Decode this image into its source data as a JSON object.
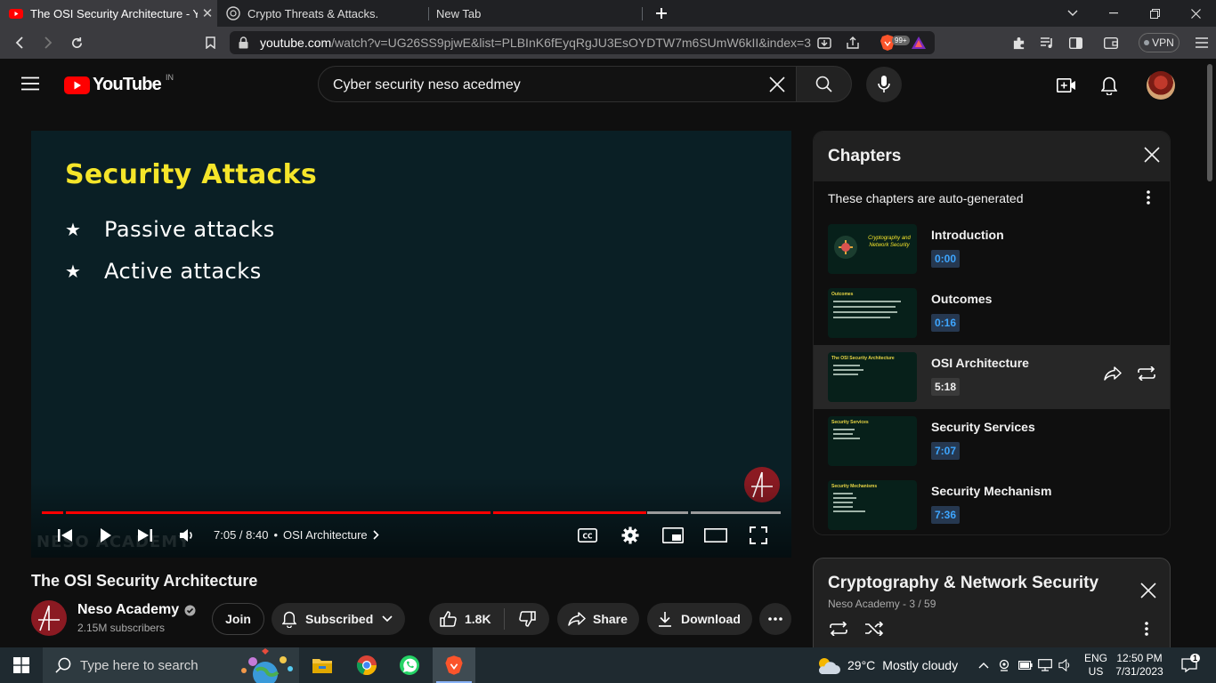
{
  "browser": {
    "tabs": [
      {
        "title": "The OSI Security Architecture - Yo",
        "active": true
      },
      {
        "title": "Crypto Threats & Attacks.",
        "active": false
      },
      {
        "title": "New Tab",
        "active": false
      }
    ],
    "url_host": "youtube.com",
    "url_path": "/watch?v=UG26SS9pjwE&list=PLBInK6fEyqRgJU3EsOYDTW7m6SUmW6kII&index=3",
    "brave_badge": "99+",
    "vpn_label": "VPN"
  },
  "youtube": {
    "logo_text": "YouTube",
    "country_code": "IN",
    "search_query": "Cyber security neso acedmey"
  },
  "player": {
    "slide_title": "Security Attacks",
    "bullets": [
      "Passive attacks",
      "Active attacks"
    ],
    "watermark": "NESO ACADEMY",
    "time": "7:05 / 8:40",
    "chapter": "OSI Architecture",
    "played_fraction": 0.815
  },
  "video": {
    "title": "The OSI Security Architecture",
    "channel": "Neso Academy",
    "subscribers": "2.15M subscribers",
    "join_label": "Join",
    "subscribed_label": "Subscribed",
    "likes": "1.8K",
    "share_label": "Share",
    "download_label": "Download"
  },
  "chapters": {
    "title": "Chapters",
    "note": "These chapters are auto-generated",
    "items": [
      {
        "name": "Introduction",
        "time": "0:00",
        "thumb": "Cryptography and Network Security"
      },
      {
        "name": "Outcomes",
        "time": "0:16",
        "thumb": "Outcomes"
      },
      {
        "name": "OSI Architecture",
        "time": "5:18",
        "thumb": "The OSI Security Architecture"
      },
      {
        "name": "Security Services",
        "time": "7:07",
        "thumb": "Security Services"
      },
      {
        "name": "Security Mechanism",
        "time": "7:36",
        "thumb": "Security Mechanisms"
      }
    ]
  },
  "playlist": {
    "title": "Cryptography & Network Security",
    "subtitle": "Neso Academy - 3 / 59"
  },
  "taskbar": {
    "search_placeholder": "Type here to search",
    "temperature": "29°C",
    "weather": "Mostly cloudy",
    "lang_top": "ENG",
    "lang_bottom": "US",
    "time": "12:50 PM",
    "date": "7/31/2023",
    "notification_count": "1"
  },
  "colors": {
    "yt_red": "#ff0000",
    "slide_title": "#f5e52a",
    "link_blue": "#3ea6ff"
  }
}
